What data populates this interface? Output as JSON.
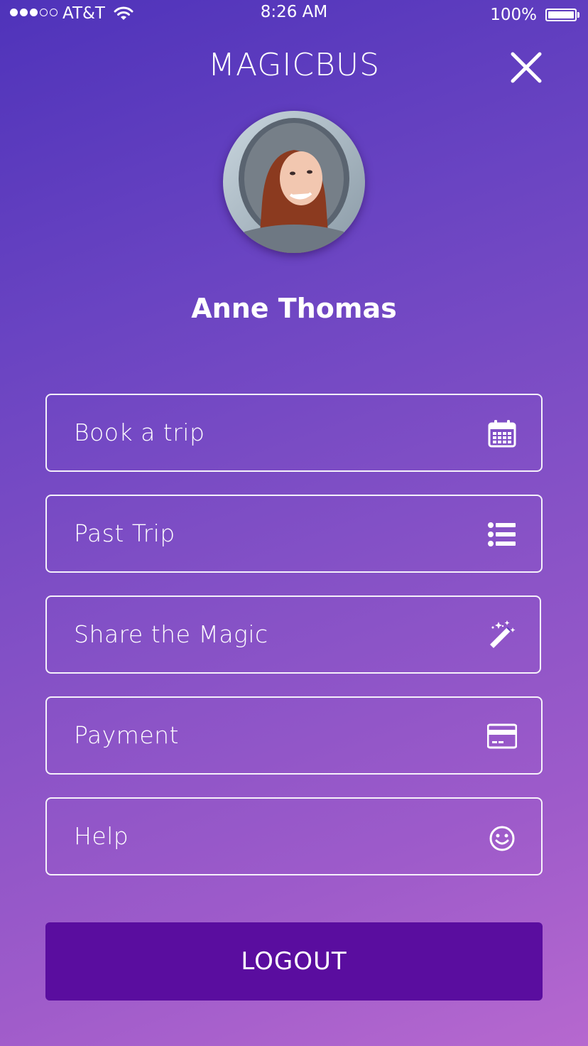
{
  "status_bar": {
    "carrier": "AT&T",
    "time": "8:26 AM",
    "battery": "100%",
    "signal_strength": 3,
    "signal_max": 5
  },
  "header": {
    "title": "MAGICBUS",
    "close_icon": "close-icon"
  },
  "profile": {
    "name": "Anne Thomas",
    "avatar_icon": "user-photo"
  },
  "menu": [
    {
      "label": "Book a trip",
      "icon": "calendar-icon"
    },
    {
      "label": "Past Trip",
      "icon": "list-icon"
    },
    {
      "label": "Share the Magic",
      "icon": "magic-wand-icon"
    },
    {
      "label": "Payment",
      "icon": "credit-card-icon"
    },
    {
      "label": "Help",
      "icon": "smiley-icon"
    }
  ],
  "logout": {
    "label": "LOGOUT",
    "color": "#5a0d9f"
  },
  "colors": {
    "gradient_top": "#4f33ba",
    "gradient_bottom": "#b668cf",
    "text": "#ffffff"
  }
}
